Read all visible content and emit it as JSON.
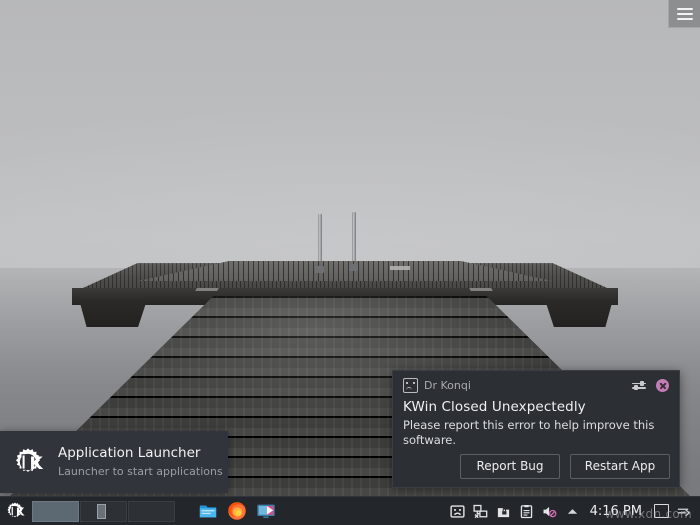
{
  "desktop": {
    "wallpaper_description": "monochrome long-exposure photograph of a wooden pier over calm water under a misty gray sky",
    "watermark": "www.xdn.com"
  },
  "window_button": {
    "name": "hamburger-menu",
    "icon": "hamburger-icon"
  },
  "notification": {
    "app_name": "Dr Konqi",
    "app_icon": "sad-face-icon",
    "configure_icon": "settings-sliders-icon",
    "close_icon": "close-icon",
    "title": "KWin Closed Unexpectedly",
    "body": "Please report this error to help improve this software.",
    "actions": [
      {
        "label": "Report Bug",
        "name": "report-bug-button"
      },
      {
        "label": "Restart App",
        "name": "restart-app-button"
      }
    ],
    "colors": {
      "background": "#2c2f34",
      "close_button": "#c47cb4",
      "text": "#f0f1f2"
    }
  },
  "launcher_tooltip": {
    "icon": "kde-logo-icon",
    "title": "Application Launcher",
    "subtitle": "Launcher to start applications",
    "background": "#31343a"
  },
  "taskbar": {
    "launcher": {
      "label": "Application Launcher",
      "icon": "kde-logo-icon"
    },
    "pager": {
      "desktops": [
        {
          "label": "Desktop 1",
          "active": true,
          "has_window": false
        },
        {
          "label": "Desktop 2",
          "active": false,
          "has_window": true
        },
        {
          "label": "Desktop 3",
          "active": false,
          "has_window": false
        }
      ]
    },
    "pinned": [
      {
        "name": "file-manager-icon",
        "label": "File Manager"
      },
      {
        "name": "firefox-icon",
        "label": "Firefox"
      },
      {
        "name": "display-icon",
        "label": "Display Configuration"
      }
    ],
    "tray": [
      {
        "name": "sad-face-icon",
        "label": "Dr Konqi"
      },
      {
        "name": "network-disconnected-icon",
        "label": "Network disconnected"
      },
      {
        "name": "lock-icon",
        "label": "Security"
      },
      {
        "name": "clipboard-icon",
        "label": "Clipboard"
      },
      {
        "name": "volume-muted-icon",
        "label": "Volume muted"
      },
      {
        "name": "chevron-up-icon",
        "label": "Show hidden icons"
      }
    ],
    "clock": "4:16 PM",
    "right_items": [
      {
        "name": "show-desktop-button",
        "label": "Show Desktop"
      },
      {
        "name": "arrow-right-icon",
        "label": "Panel options"
      }
    ],
    "background": "#23262b"
  }
}
